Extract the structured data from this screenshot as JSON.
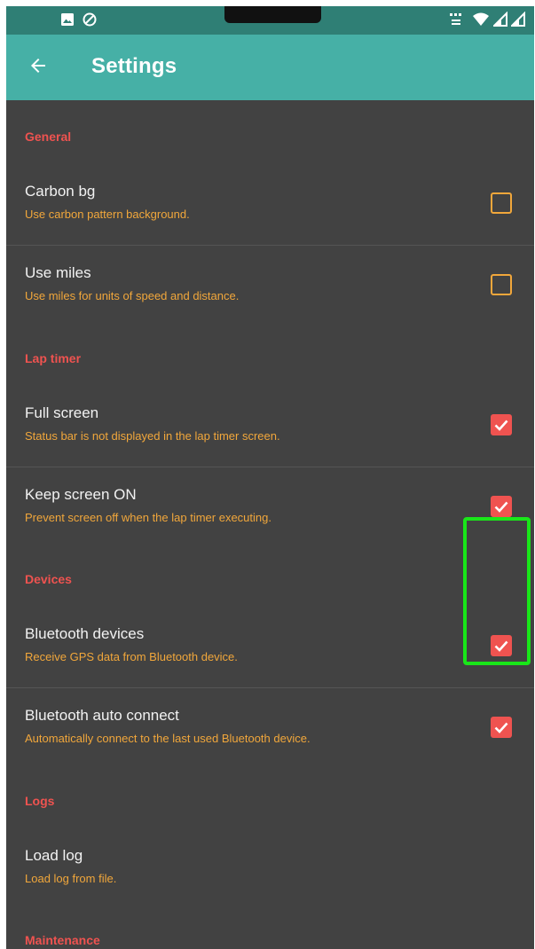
{
  "app_bar": {
    "title": "Settings"
  },
  "sections": {
    "general": {
      "header": "General",
      "carbon_bg": {
        "title": "Carbon bg",
        "summary": "Use carbon pattern background.",
        "checked": false
      },
      "use_miles": {
        "title": "Use miles",
        "summary": "Use miles for units of speed and distance.",
        "checked": false
      }
    },
    "lap_timer": {
      "header": "Lap timer",
      "full_screen": {
        "title": "Full screen",
        "summary": "Status bar is not displayed in the lap timer screen.",
        "checked": true
      },
      "keep_screen_on": {
        "title": "Keep screen ON",
        "summary": "Prevent screen off when the lap timer executing.",
        "checked": true
      }
    },
    "devices": {
      "header": "Devices",
      "bluetooth_devices": {
        "title": "Bluetooth devices",
        "summary": "Receive GPS data from Bluetooth device.",
        "checked": true
      },
      "bluetooth_auto_connect": {
        "title": "Bluetooth auto connect",
        "summary": "Automatically connect to the last used Bluetooth device.",
        "checked": true
      }
    },
    "logs": {
      "header": "Logs",
      "load_log": {
        "title": "Load log",
        "summary": "Load log from file."
      }
    },
    "maintenance": {
      "header": "Maintenance"
    }
  },
  "colors": {
    "status_bar": "#2f7f75",
    "app_bar": "#46b0a6",
    "background": "#424242",
    "section_header": "#ef5350",
    "summary_text": "#f1a73b",
    "checkbox_checked": "#ef5350",
    "highlight_box": "#19e619"
  },
  "icons": {
    "status_left": [
      "image-icon",
      "do-not-disturb-icon"
    ],
    "status_right": [
      "data-speed-icon",
      "wifi-icon",
      "signal-icon",
      "signal-icon"
    ],
    "navigation": "arrow-back-icon",
    "checkbox_checked": "check-icon"
  }
}
